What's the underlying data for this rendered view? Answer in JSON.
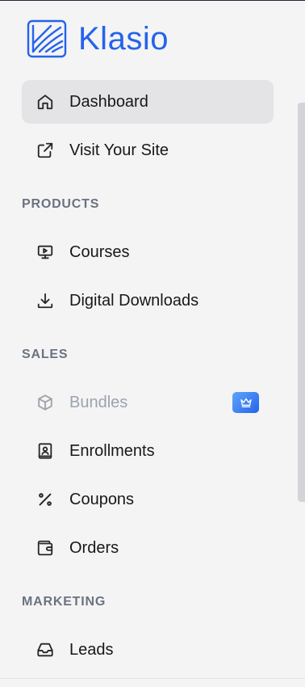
{
  "brand": {
    "name": "Klasio",
    "color": "#2563eb"
  },
  "nav": {
    "dashboard": {
      "label": "Dashboard",
      "icon": "home-icon",
      "active": true
    },
    "visit_site": {
      "label": "Visit Your Site",
      "icon": "external-link-icon"
    }
  },
  "sections": {
    "products": {
      "title": "PRODUCTS",
      "items": [
        {
          "label": "Courses",
          "icon": "presentation-icon"
        },
        {
          "label": "Digital Downloads",
          "icon": "download-icon"
        }
      ]
    },
    "sales": {
      "title": "SALES",
      "items": [
        {
          "label": "Bundles",
          "icon": "box-icon",
          "disabled": true,
          "badge": "crown-icon"
        },
        {
          "label": "Enrollments",
          "icon": "contact-book-icon"
        },
        {
          "label": "Coupons",
          "icon": "percent-icon"
        },
        {
          "label": "Orders",
          "icon": "wallet-icon"
        }
      ]
    },
    "marketing": {
      "title": "MARKETING",
      "items": [
        {
          "label": "Leads",
          "icon": "inbox-icon"
        }
      ]
    }
  },
  "colors": {
    "active_bg": "#e4e4e7",
    "text": "#18181b",
    "muted_text": "#9ca3af",
    "section_text": "#6b7280",
    "badge": "#3b82f6"
  }
}
